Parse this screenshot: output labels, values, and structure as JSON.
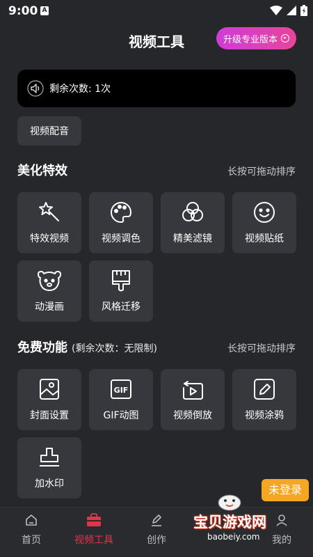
{
  "status": {
    "time": "9:00",
    "app_letter": "A"
  },
  "header": {
    "title": "视频工具",
    "upgrade_label": "升级专业版本"
  },
  "remaining": {
    "text": "剩余次数: 1次"
  },
  "dubbing": {
    "label": "视频配音"
  },
  "beauty": {
    "title": "美化特效",
    "hint": "长按可拖动排序",
    "items": [
      {
        "label": "特效视频",
        "icon": "magic-wand-icon"
      },
      {
        "label": "视频调色",
        "icon": "palette-icon"
      },
      {
        "label": "精美滤镜",
        "icon": "filter-icon"
      },
      {
        "label": "视频贴纸",
        "icon": "smiley-icon"
      },
      {
        "label": "动漫画",
        "icon": "bear-icon"
      },
      {
        "label": "风格迁移",
        "icon": "brush-icon"
      }
    ]
  },
  "free": {
    "title": "免费功能",
    "subtitle": "(剩余次数：无限制)",
    "hint": "长按可拖动排序",
    "items": [
      {
        "label": "封面设置",
        "icon": "cover-image-icon"
      },
      {
        "label": "GIF动图",
        "icon": "gif-icon"
      },
      {
        "label": "视频倒放",
        "icon": "reverse-play-icon"
      },
      {
        "label": "视频涂鸦",
        "icon": "pencil-icon"
      },
      {
        "label": "加水印",
        "icon": "stamp-icon"
      }
    ],
    "gif_icon_text": "GIF"
  },
  "nav": {
    "items": [
      {
        "label": "首页",
        "icon": "home-icon"
      },
      {
        "label": "视频工具",
        "icon": "toolbox-icon"
      },
      {
        "label": "创作",
        "icon": "pen-icon"
      },
      {
        "label": "我的",
        "icon": "profile-icon"
      }
    ],
    "active_index": 1
  },
  "overlay": {
    "login_badge": "未登录",
    "watermark_text": "宝贝游戏网",
    "watermark_url": "baobeiy.com"
  },
  "colors": {
    "accent": "#e5334a",
    "tile_bg": "#37383d",
    "page_bg": "#26272b"
  }
}
